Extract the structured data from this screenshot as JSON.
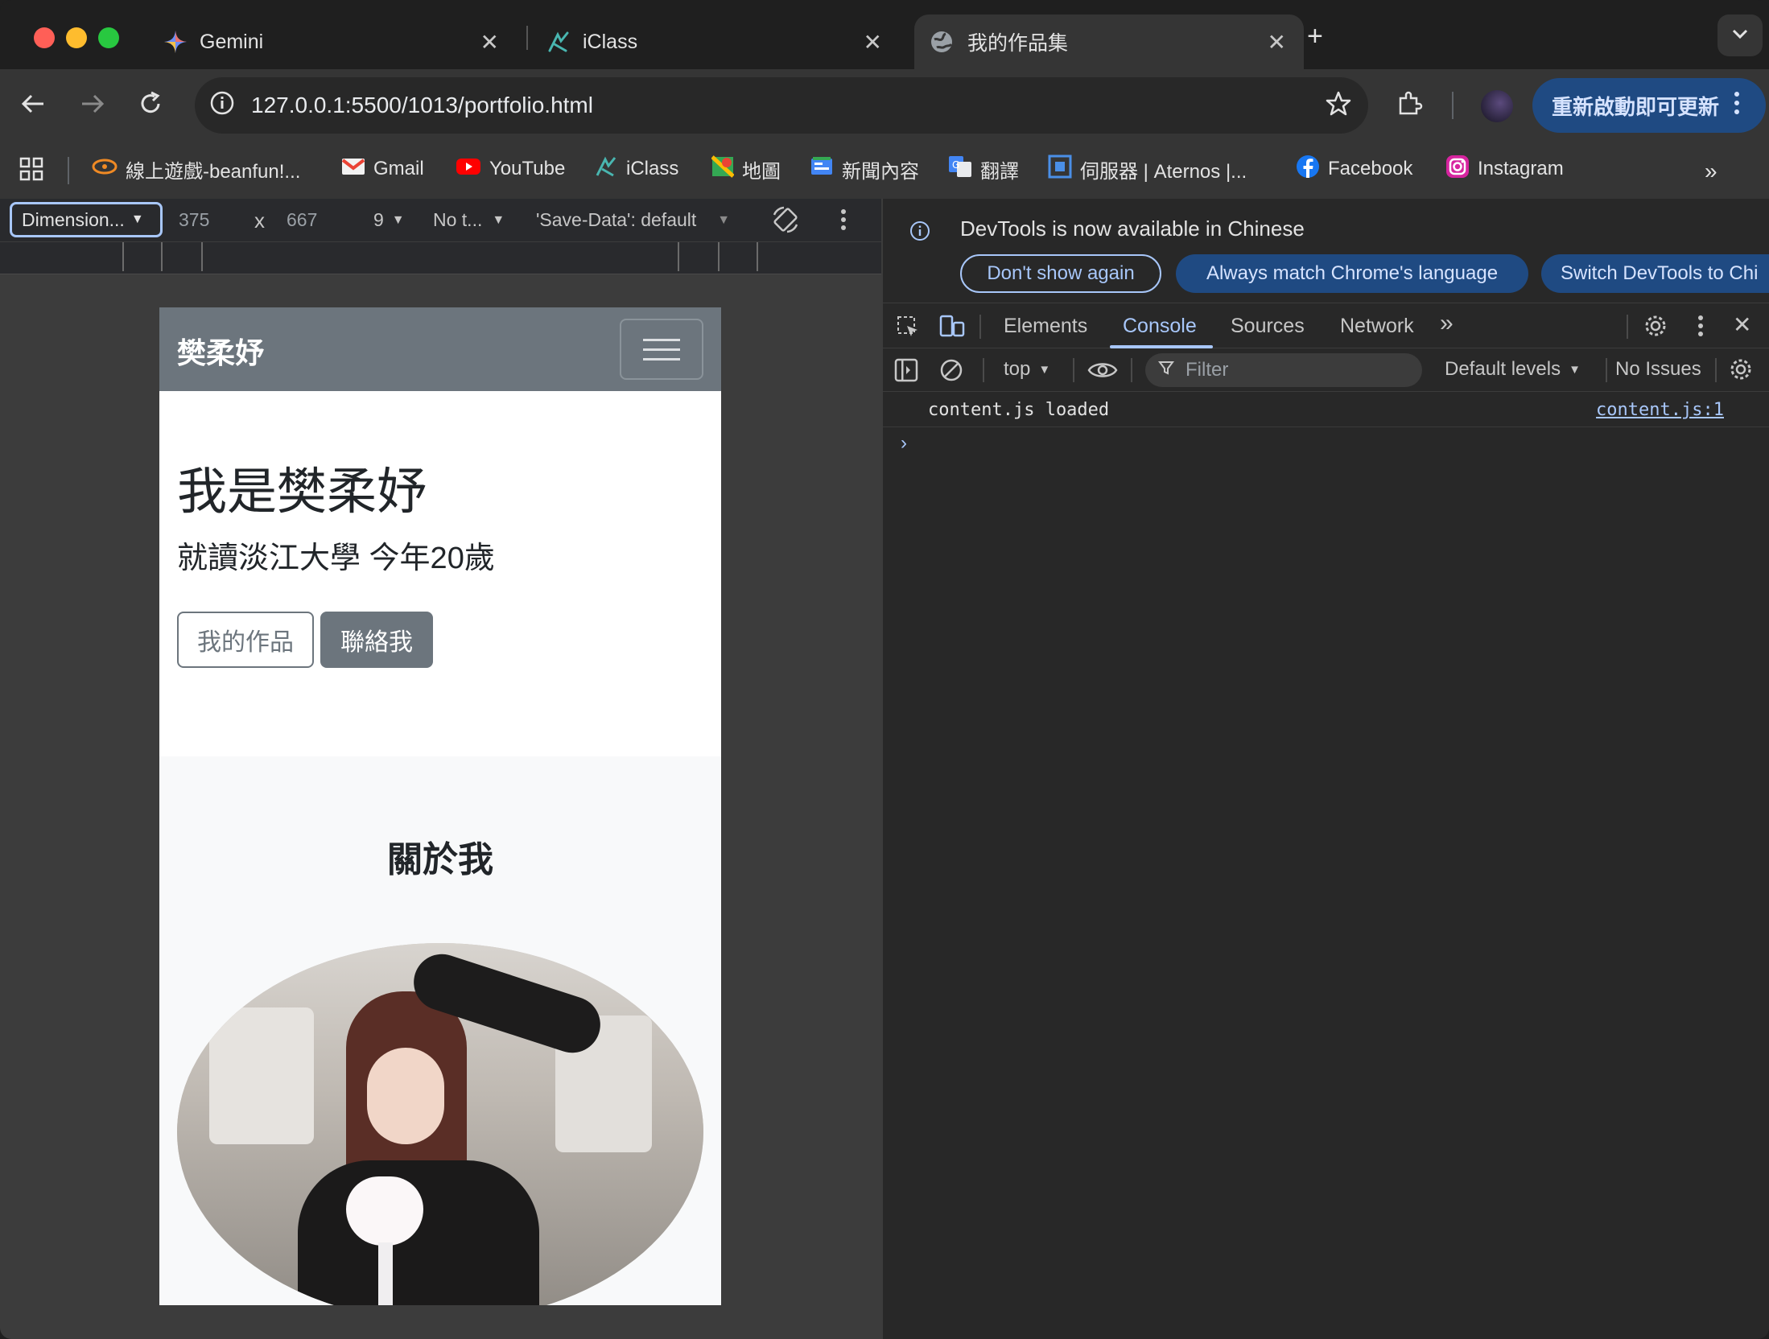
{
  "tabs": [
    {
      "title": "Gemini",
      "icon": "gemini-icon"
    },
    {
      "title": "iClass",
      "icon": "iclass-icon"
    },
    {
      "title": "我的作品集",
      "icon": "globe-icon",
      "active": true
    }
  ],
  "omnibox": {
    "url": "127.0.0.1:5500/1013/portfolio.html"
  },
  "update_button": "重新啟動即可更新",
  "bookmarks": [
    {
      "label": "線上遊戲-beanfun!...",
      "icon": "beanfun-icon"
    },
    {
      "label": "Gmail",
      "icon": "gmail-icon"
    },
    {
      "label": "YouTube",
      "icon": "youtube-icon"
    },
    {
      "label": "iClass",
      "icon": "iclass-icon"
    },
    {
      "label": "地圖",
      "icon": "maps-icon"
    },
    {
      "label": "新聞內容",
      "icon": "news-icon"
    },
    {
      "label": "翻譯",
      "icon": "translate-icon"
    },
    {
      "label": "伺服器 | Aternos |...",
      "icon": "aternos-icon"
    },
    {
      "label": "Facebook",
      "icon": "facebook-icon"
    },
    {
      "label": "Instagram",
      "icon": "instagram-icon"
    }
  ],
  "device_toolbar": {
    "dimensions": "Dimension...",
    "width": "375",
    "times": "x",
    "height": "667",
    "zoom": "9",
    "throttle": "No t...",
    "save_data": "'Save-Data': default"
  },
  "page": {
    "brand": "樊柔妤",
    "hero_title": "我是樊柔妤",
    "hero_subtitle": "就讀淡江大學 今年20歲",
    "btn_works": "我的作品",
    "btn_contact": "聯絡我",
    "about_title": "關於我"
  },
  "devtools": {
    "banner_text": "DevTools is now available in Chinese",
    "btn_dont_show": "Don't show again",
    "btn_match": "Always match Chrome's language",
    "btn_switch": "Switch DevTools to Chi",
    "tabs": [
      "Elements",
      "Console",
      "Sources",
      "Network"
    ],
    "active_tab": "Console",
    "context": "top",
    "filter_placeholder": "Filter",
    "levels": "Default levels",
    "issues": "No Issues",
    "console_message": "content.js loaded",
    "console_source": "content.js:1"
  },
  "colors": {
    "accent_blue": "#a8c7fa",
    "navbar_gray": "#6c757d",
    "update_pill": "#1f4a82"
  }
}
